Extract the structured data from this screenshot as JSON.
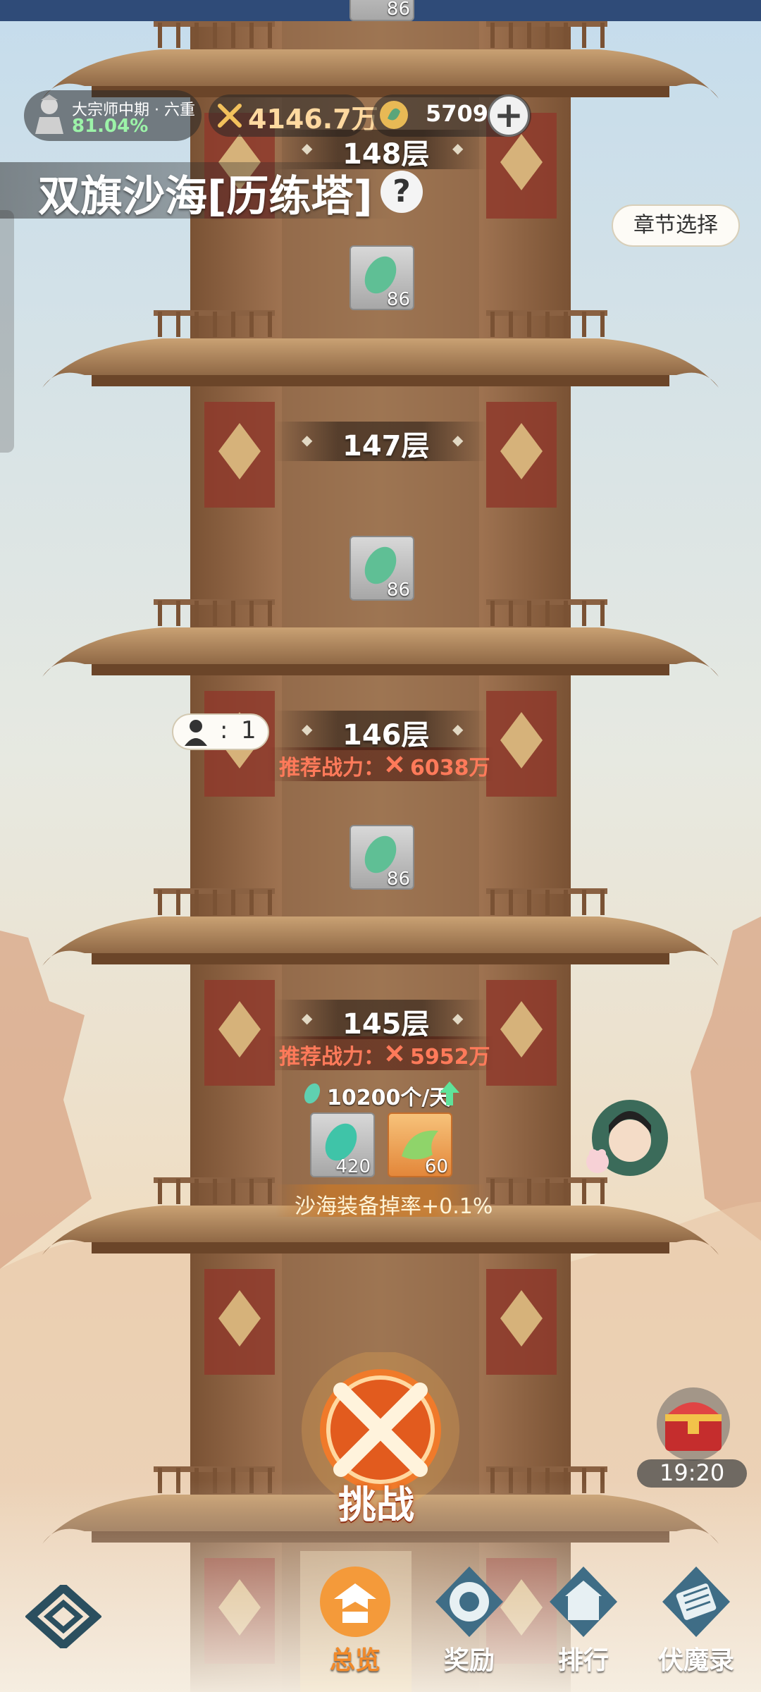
{
  "header": {
    "rank_title": "大宗师中期 · 六重",
    "rank_percent": "81.04%",
    "combat_power": "4146.7万",
    "gem_count": "5709",
    "plus_label": "+",
    "page_title": "双旗沙海[历练塔]",
    "help_label": "?",
    "chapter_select": "章节选择"
  },
  "tower": {
    "floors": [
      {
        "label": "148层",
        "reward_count": "86"
      },
      {
        "label": "147层",
        "reward_count": "86"
      },
      {
        "label": "146层",
        "reward_count": "86",
        "recommend": "推荐战力：",
        "recommend_value": "6038万",
        "players": "1"
      },
      {
        "label": "145层",
        "recommend": "推荐战力：",
        "recommend_value": "5952万",
        "daily": "10200个/天",
        "rewards": [
          {
            "count": "420"
          },
          {
            "count": "60"
          }
        ],
        "bonus": "沙海装备掉率+0.1%"
      }
    ],
    "top_partial_count": "86",
    "player_sep": ":"
  },
  "actions": {
    "challenge_label": "挑战",
    "chest_timer": "19:20"
  },
  "nav": {
    "items": [
      {
        "label": "总览",
        "icon": "pagoda-icon",
        "active": true
      },
      {
        "label": "奖励",
        "icon": "reward-icon",
        "active": false
      },
      {
        "label": "排行",
        "icon": "ranking-icon",
        "active": false
      },
      {
        "label": "伏魔录",
        "icon": "scroll-icon",
        "active": false
      }
    ]
  },
  "colors": {
    "accent_orange": "#f28a2a",
    "recommend_red": "#ff7a5a",
    "percent_green": "#9cf3a8",
    "gold": "#ffd9a0"
  }
}
